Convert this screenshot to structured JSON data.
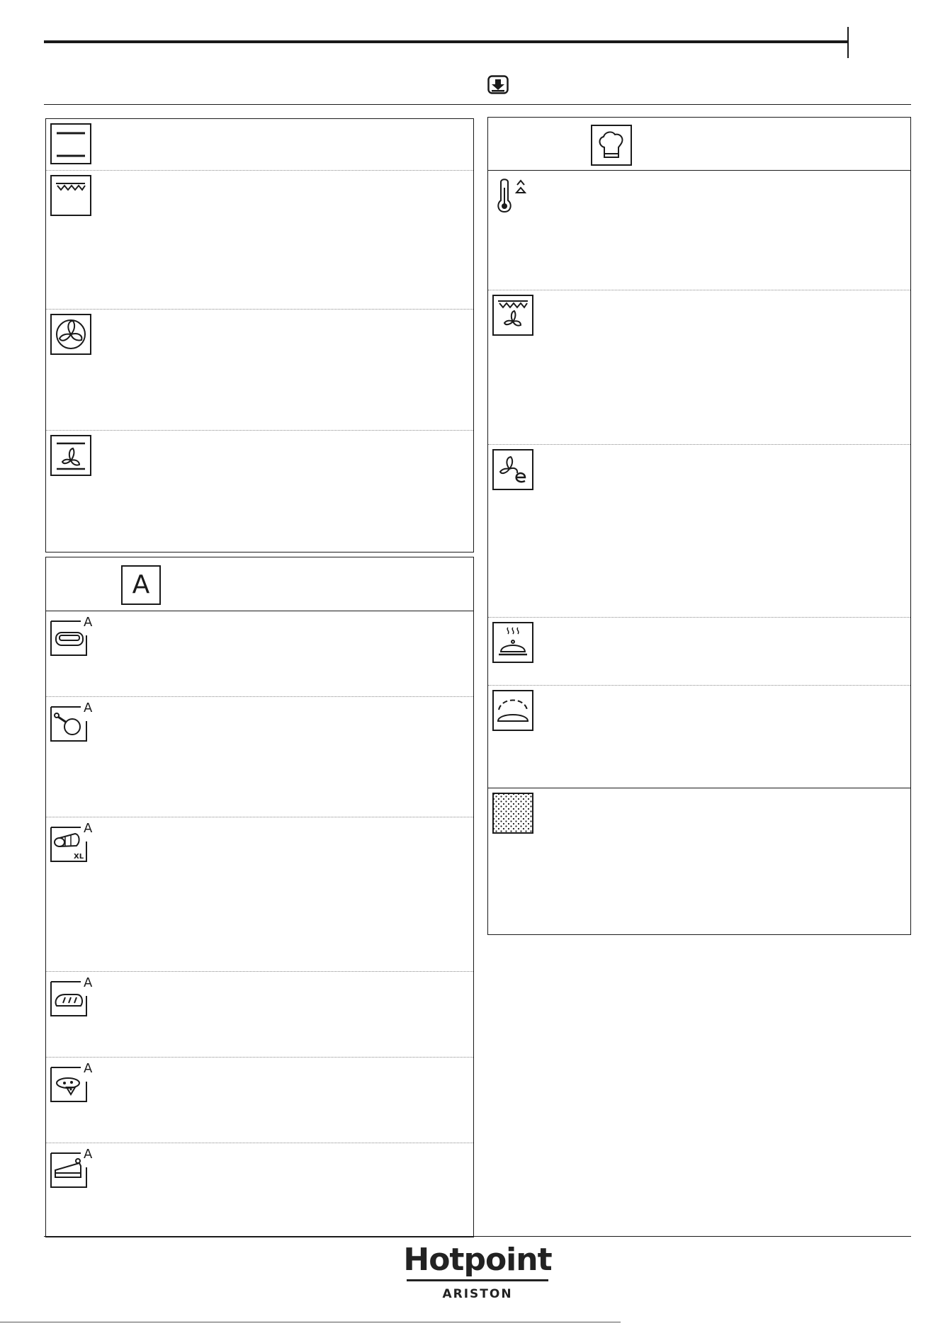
{
  "brand": {
    "logo_text": "Hotpoint",
    "logo_subtext": "ARISTON"
  },
  "panels": {
    "traditional": {
      "rows": [
        {
          "icon": "top-bottom-heating-icon"
        },
        {
          "icon": "grill-icon"
        },
        {
          "icon": "forced-air-fan-icon"
        },
        {
          "icon": "bottom-heating-fan-icon"
        }
      ]
    },
    "auto": {
      "header_label": "A",
      "rows": [
        {
          "icon": "auto-lasagna-icon",
          "badge": "A"
        },
        {
          "icon": "auto-chicken-icon",
          "badge": "A"
        },
        {
          "icon": "auto-roast-xl-icon",
          "badge": "A",
          "extra": "XL"
        },
        {
          "icon": "auto-bread-icon",
          "badge": "A"
        },
        {
          "icon": "auto-pizza-icon",
          "badge": "A"
        },
        {
          "icon": "auto-cake-icon",
          "badge": "A"
        }
      ]
    },
    "special": {
      "header_icon": "chef-hat-icon",
      "rows": [
        {
          "icon": "fast-preheat-icon"
        },
        {
          "icon": "turbo-grill-icon"
        },
        {
          "icon": "eco-forced-air-icon"
        },
        {
          "icon": "keep-warm-icon"
        },
        {
          "icon": "rising-dough-icon"
        },
        {
          "icon": "pyrolytic-clean-icon"
        }
      ]
    }
  },
  "header": {
    "icon": "save-download-icon"
  }
}
